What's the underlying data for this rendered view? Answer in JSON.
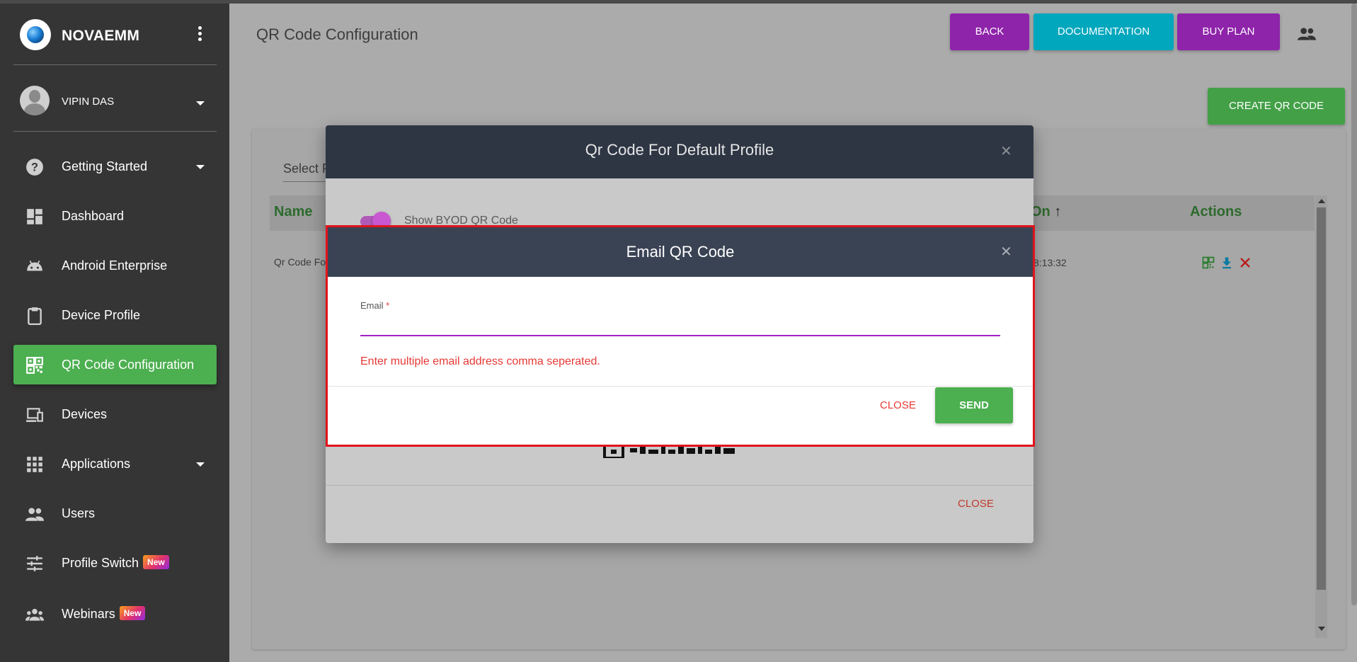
{
  "app": {
    "brand": "NOVAEMM",
    "user_name": "VIPIN DAS"
  },
  "sidebar": {
    "items": [
      {
        "label": "Getting Started",
        "icon": "help-circle-icon",
        "has_caret": true
      },
      {
        "label": "Dashboard",
        "icon": "dashboard-icon"
      },
      {
        "label": "Android Enterprise",
        "icon": "android-icon"
      },
      {
        "label": "Device Profile",
        "icon": "clipboard-icon"
      },
      {
        "label": "QR Code Configuration",
        "icon": "qr-code-icon",
        "active": true
      },
      {
        "label": "Devices",
        "icon": "devices-icon"
      },
      {
        "label": "Applications",
        "icon": "apps-grid-icon",
        "has_caret": true
      },
      {
        "label": "Users",
        "icon": "users-icon"
      },
      {
        "label": "Profile Switch",
        "icon": "sliders-icon",
        "badge": "New"
      },
      {
        "label": "Webinars",
        "icon": "group-icon",
        "badge": "New"
      }
    ]
  },
  "header": {
    "title": "QR Code Configuration",
    "buttons": {
      "back": "BACK",
      "documentation": "DOCUMENTATION",
      "buy_plan": "BUY PLAN"
    },
    "colors": {
      "back": "#8e24aa",
      "documentation": "#00a7bd",
      "buy_plan": "#8e24aa"
    }
  },
  "main": {
    "create_button": "CREATE QR CODE",
    "select_label": "Select P",
    "table": {
      "headers": {
        "name": "Name",
        "created_on": "On",
        "actions": "Actions"
      },
      "row": {
        "name": "Qr Code Fo",
        "created_on": "8:13:32"
      }
    }
  },
  "qr_dialog": {
    "title": "Qr Code For Default Profile",
    "toggle_label": "Show BYOD QR Code",
    "close_label": "CLOSE"
  },
  "email_dialog": {
    "title": "Email QR Code",
    "email_label": "Email",
    "required_mark": "*",
    "email_value": "",
    "helper_text": "Enter multiple email address comma seperated.",
    "close_label": "CLOSE",
    "send_label": "SEND"
  },
  "colors": {
    "accent_green": "#4caf50",
    "error_red": "#e53935",
    "sidebar_bg": "#353535",
    "dialog_header": "#3a4354"
  }
}
